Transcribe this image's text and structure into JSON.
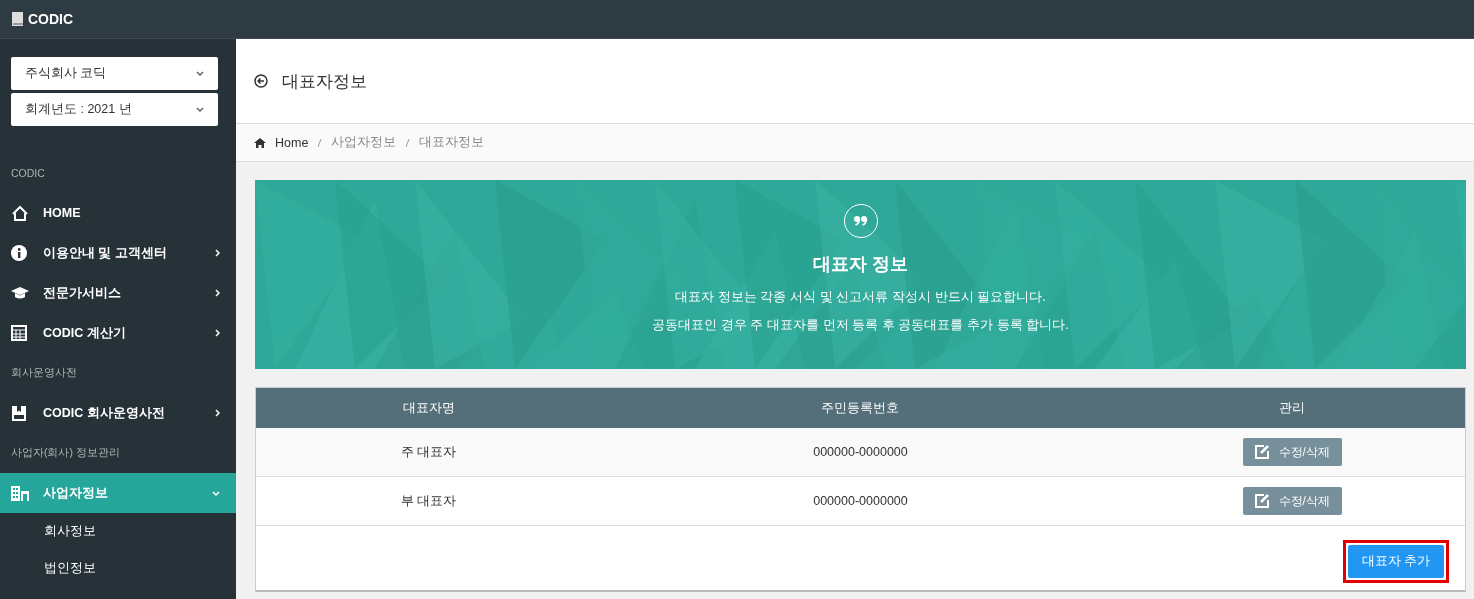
{
  "app": {
    "title": "CODIC"
  },
  "sidebar": {
    "selects": [
      {
        "value": "주식회사 코딕"
      },
      {
        "value": "회계년도 : 2021 년"
      }
    ],
    "sections": [
      {
        "label": "CODIC",
        "items": [
          {
            "label": "HOME",
            "kind": "home",
            "expanded": false,
            "selected": false
          },
          {
            "label": "이용안내 및 고객센터",
            "kind": "info",
            "expanded": false,
            "selected": false
          },
          {
            "label": "전문가서비스",
            "kind": "education",
            "expanded": false,
            "selected": false
          },
          {
            "label": "CODIC 계산기",
            "kind": "calculator",
            "expanded": false,
            "selected": false
          }
        ]
      },
      {
        "label": "회사운영사전",
        "items": [
          {
            "label": "CODIC 회사운영사전",
            "kind": "dictionary",
            "expanded": false,
            "selected": false
          }
        ]
      },
      {
        "label": "사업자(회사) 정보관리",
        "items": [
          {
            "label": "사업자정보",
            "kind": "business",
            "expanded": true,
            "selected": true,
            "children": [
              {
                "label": "회사정보"
              },
              {
                "label": "법인정보"
              }
            ]
          }
        ]
      }
    ]
  },
  "page": {
    "title": "대표자정보",
    "breadcrumb": [
      "Home",
      "사업자정보",
      "대표자정보"
    ]
  },
  "banner": {
    "title": "대표자 정보",
    "lines": [
      "대표자 정보는 각종 서식 및 신고서류 작성시 반드시 필요합니다.",
      "공동대표인 경우 주 대표자를 먼저 등록 후 공동대표를 추가 등록 합니다."
    ]
  },
  "table": {
    "columns": [
      "대표자명",
      "주민등록번호",
      "관리"
    ],
    "rows": [
      {
        "name": "주 대표자",
        "id_number": "000000-0000000",
        "action": "수정/삭제"
      },
      {
        "name": "부 대표자",
        "id_number": "000000-0000000",
        "action": "수정/삭제"
      }
    ],
    "add_button": {
      "label": "대표자 추가",
      "highlighted": true
    }
  }
}
